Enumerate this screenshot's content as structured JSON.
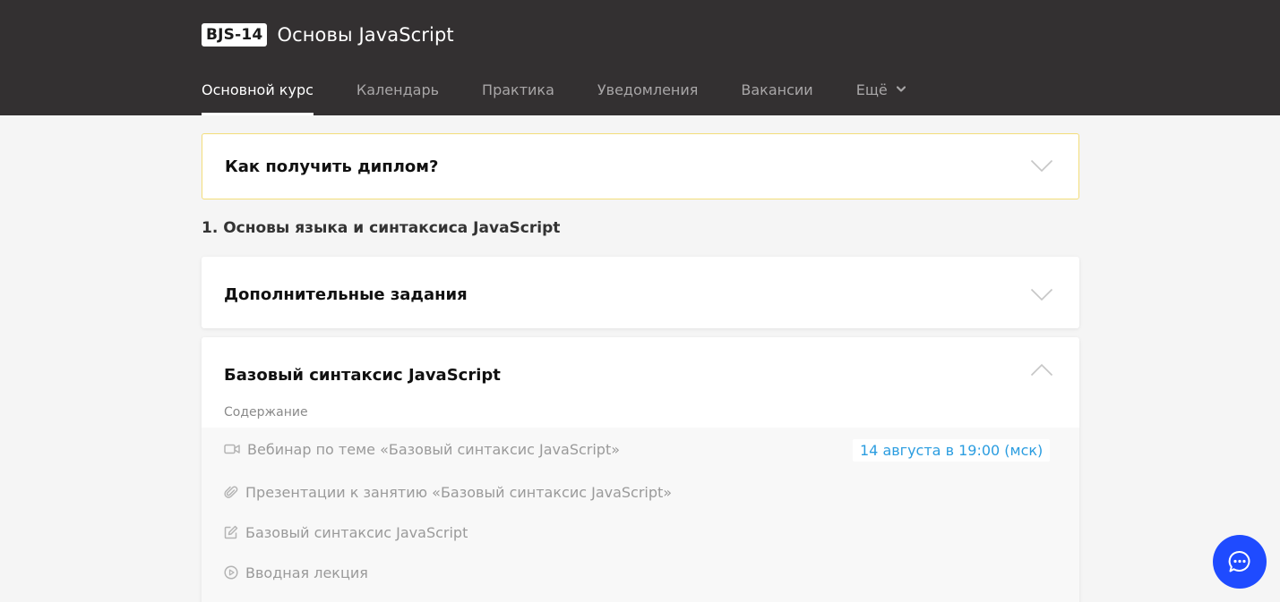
{
  "header": {
    "course_code": "BJS-14",
    "course_title": "Основы JavaScript"
  },
  "nav": {
    "items": [
      {
        "label": "Основной курс",
        "active": true
      },
      {
        "label": "Календарь"
      },
      {
        "label": "Практика"
      },
      {
        "label": "Уведомления"
      },
      {
        "label": "Вакансии"
      }
    ],
    "more_label": "Ещё"
  },
  "diploma_card": {
    "title": "Как получить диплом?",
    "accent_color": "#f3dd7a"
  },
  "section": {
    "heading": "1. Основы языка и синтаксиса JavaScript"
  },
  "extra_card": {
    "title": "Дополнительные задания"
  },
  "basic_card": {
    "title": "Базовый синтаксис JavaScript",
    "contents_label": "Содержание",
    "lessons": [
      {
        "icon": "video-camera-icon",
        "label": "Вебинар по теме «Базовый синтаксис JavaScript»",
        "date": "14 августа в 19:00 (мск)"
      },
      {
        "icon": "paperclip-icon",
        "label": "Презентации к занятию «Базовый синтаксис JavaScript»"
      },
      {
        "icon": "edit-icon",
        "label": "Базовый синтаксис JavaScript"
      },
      {
        "icon": "play-circle-icon",
        "label": "Вводная лекция"
      }
    ]
  },
  "chat": {
    "icon": "chat-bubble-icon",
    "color": "#1f4bff"
  }
}
